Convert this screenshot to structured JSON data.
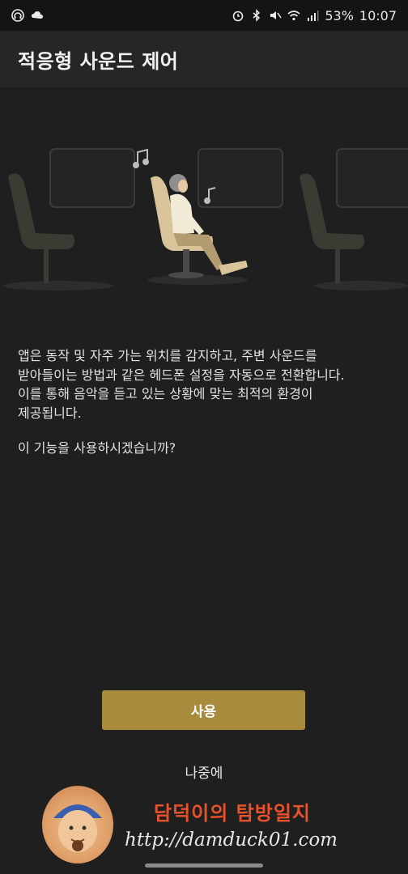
{
  "status_bar": {
    "battery": "53%",
    "time": "10:07"
  },
  "app_bar": {
    "title": "적응형 사운드 제어"
  },
  "content": {
    "description_lines": [
      "앱은 동작 및 자주 가는 위치를 감지하고, 주변 사운드를",
      "받아들이는 방법과 같은 헤드폰 설정을 자동으로 전환합니다.",
      "이를 통해 음악을 듣고 있는 상황에 맞는 최적의 환경이",
      "제공됩니다."
    ],
    "question": "이 기능을 사용하시겠습니까?"
  },
  "buttons": {
    "use": "사용",
    "later": "나중에"
  },
  "watermark": {
    "title": "담덕이의 탐방일지",
    "url": "http://damduck01.com"
  },
  "colors": {
    "background": "#1f1f1f",
    "app_bar": "#262626",
    "accent": "#a98b3e"
  }
}
